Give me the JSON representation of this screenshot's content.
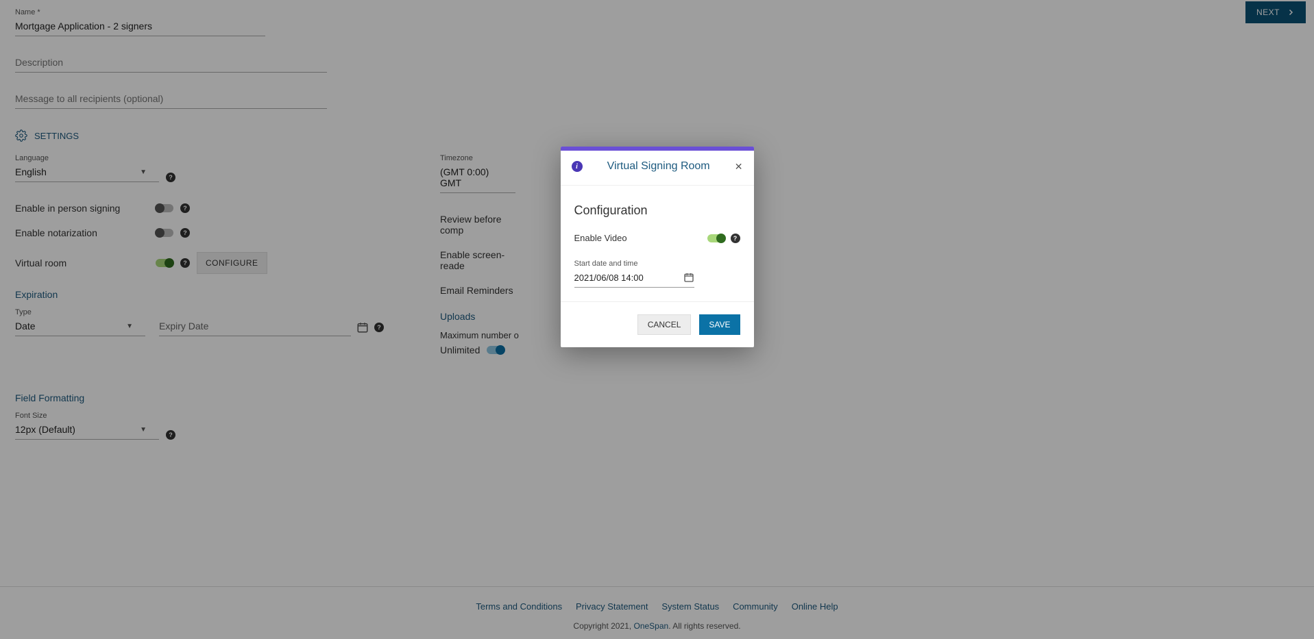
{
  "header": {
    "next_label": "NEXT"
  },
  "fields": {
    "name_label": "Name *",
    "name_value": "Mortgage Application - 2 signers",
    "desc_placeholder": "Description",
    "msg_placeholder": "Message to all recipients (optional)"
  },
  "settings": {
    "title": "SETTINGS",
    "language_label": "Language",
    "language_value": "English",
    "timezone_label": "Timezone",
    "timezone_value": "(GMT 0:00) GMT",
    "in_person_label": "Enable in person signing",
    "in_person_on": false,
    "notarization_label": "Enable notarization",
    "notarization_on": false,
    "virtual_room_label": "Virtual room",
    "virtual_room_on": true,
    "configure_label": "CONFIGURE",
    "review_label": "Review before comp",
    "screen_reader_label": "Enable screen-reade",
    "email_reminders_label": "Email Reminders"
  },
  "expiration": {
    "title": "Expiration",
    "type_label": "Type",
    "type_value": "Date",
    "expiry_date_label": "Expiry Date"
  },
  "uploads": {
    "title": "Uploads",
    "max_label": "Maximum number o",
    "unlimited_label": "Unlimited",
    "unlimited_on": true
  },
  "field_formatting": {
    "title": "Field Formatting",
    "font_size_label": "Font Size",
    "font_size_value": "12px (Default)"
  },
  "footer": {
    "links": {
      "terms": "Terms and Conditions",
      "privacy": "Privacy Statement",
      "status": "System Status",
      "community": "Community",
      "help": "Online Help"
    },
    "copyright_prefix": "Copyright 2021, ",
    "copyright_brand": "OneSpan",
    "copyright_suffix": ". All rights reserved."
  },
  "modal": {
    "title": "Virtual Signing Room",
    "config_heading": "Configuration",
    "enable_video_label": "Enable Video",
    "enable_video_on": true,
    "start_label": "Start date and time",
    "start_value": "2021/06/08 14:00",
    "cancel_label": "CANCEL",
    "save_label": "SAVE"
  }
}
